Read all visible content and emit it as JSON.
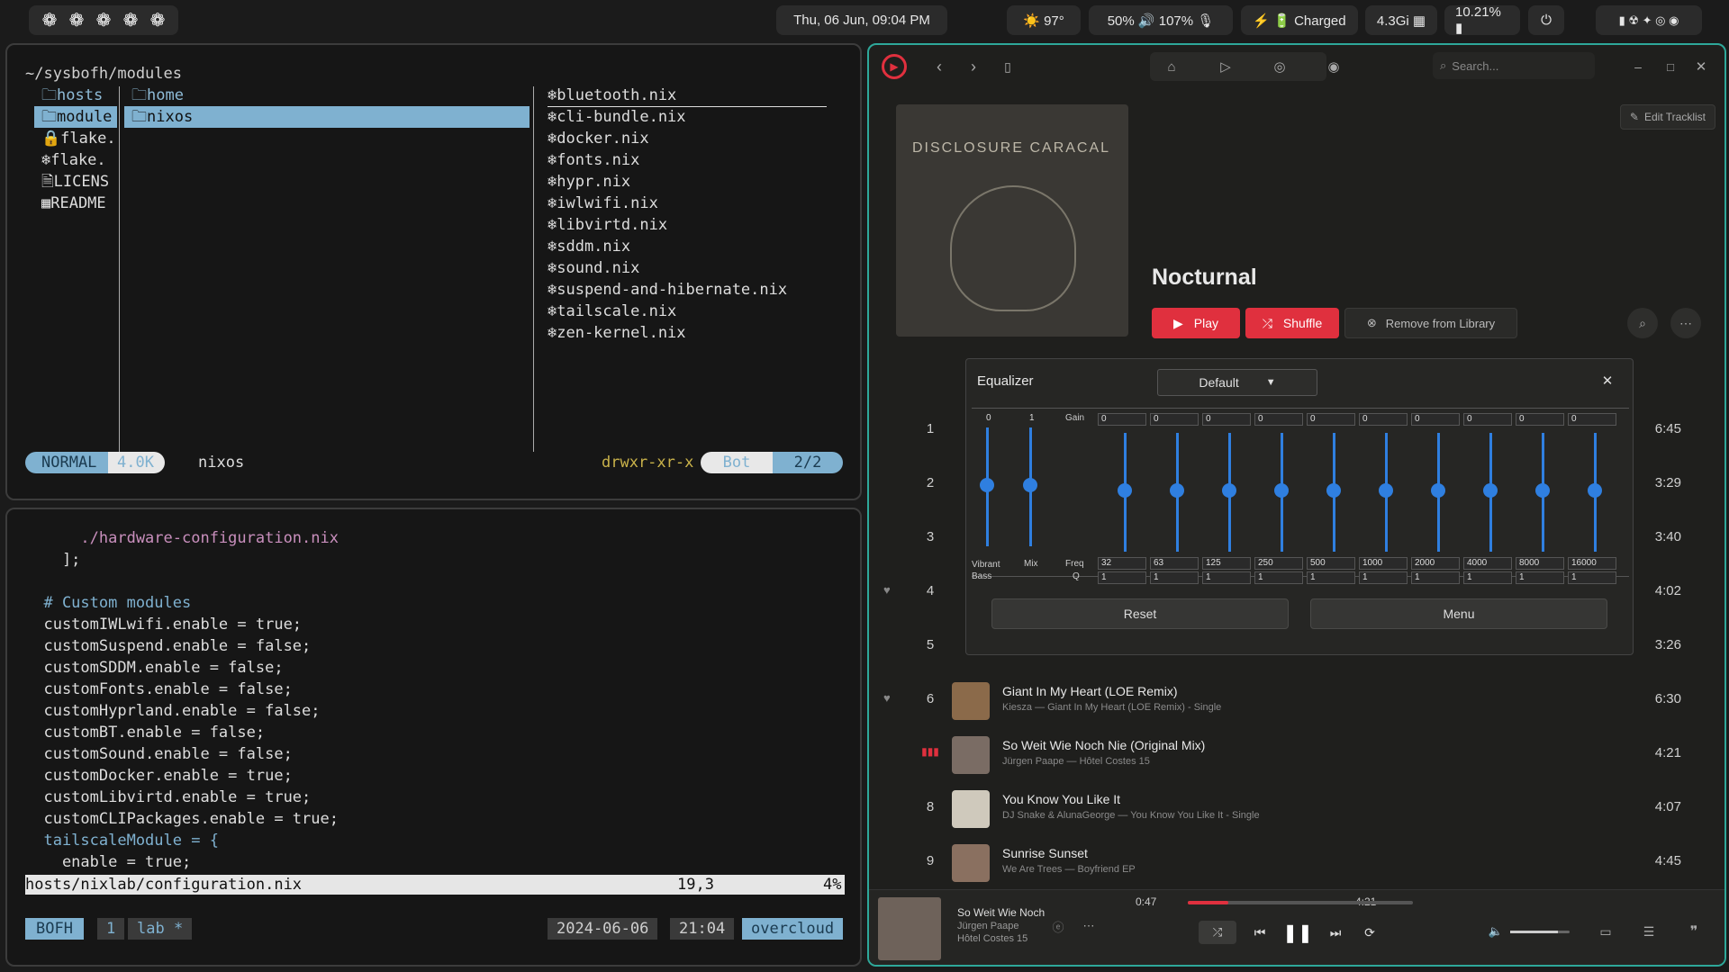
{
  "topbar": {
    "workspaces": [
      "❁",
      "❁",
      "❁",
      "❁",
      "❁"
    ],
    "clock": "Thu, 06 Jun, 09:04 PM",
    "weather": "☀️ 97°",
    "audio": "50% 🔊 107% 🎙",
    "battery": "⚡ 🔋 Charged",
    "memory": "4.3Gi ▦",
    "cpu": "10.21% ▮",
    "power_icon": "⏻",
    "tray_icons": "▮ ☢ ✦ ◎ ◉"
  },
  "files": {
    "path": "~/sysbofh/modules",
    "col1": [
      "🗀hosts",
      "🗀module",
      "🔒flake.",
      "❄flake.",
      "🗎LICENS",
      "▦README"
    ],
    "col2": [
      "🗀home",
      "🗀nixos"
    ],
    "col3": [
      "❄bluetooth.nix",
      "❄cli-bundle.nix",
      "❄docker.nix",
      "❄fonts.nix",
      "❄hypr.nix",
      "❄iwlwifi.nix",
      "❄libvirtd.nix",
      "❄sddm.nix",
      "❄sound.nix",
      "❄suspend-and-hibernate.nix",
      "❄tailscale.nix",
      "❄zen-kernel.nix"
    ],
    "mode": "NORMAL",
    "size": "4.0K",
    "current": "nixos",
    "perms": "drwxr-xr-x",
    "pos_label": "Bot",
    "pos": "2/2"
  },
  "editor": {
    "lines": [
      "      ./hardware-configuration.nix",
      "    ];",
      "",
      "  # Custom modules",
      "  customIWLwifi.enable = true;",
      "  customSuspend.enable = false;",
      "  customSDDM.enable = false;",
      "  customFonts.enable = false;",
      "  customHyprland.enable = false;",
      "  customBT.enable = false;",
      "  customSound.enable = false;",
      "  customDocker.enable = true;",
      "  customLibvirtd.enable = true;",
      "  customCLIPackages.enable = true;",
      "  tailscaleModule = {",
      "    enable = true;"
    ],
    "status_file": "hosts/nixlab/configuration.nix",
    "status_pos": "19,3",
    "status_pct": "4%",
    "tmux_session": "BOFH",
    "tmux_win": "1",
    "tmux_name": "lab *",
    "date": "2024-06-06",
    "time": "21:04",
    "host": "overcloud"
  },
  "music": {
    "search_placeholder": "Search...",
    "edit_tracklist": "Edit Tracklist",
    "album_art_text": "DISCLOSURE CARACAL",
    "album_title": "Nocturnal",
    "play": "Play",
    "shuffle": "Shuffle",
    "remove": "Remove from Library",
    "tracks": [
      {
        "n": "1",
        "title": "",
        "sub": "",
        "dur": "6:45"
      },
      {
        "n": "2",
        "title": "",
        "sub": "",
        "dur": "3:29"
      },
      {
        "n": "3",
        "title": "",
        "sub": "",
        "dur": "3:40"
      },
      {
        "n": "4",
        "title": "",
        "sub": "",
        "dur": "4:02"
      },
      {
        "n": "5",
        "title": "",
        "sub": "",
        "dur": "3:26"
      },
      {
        "n": "6",
        "title": "Giant In My Heart (LOE Remix)",
        "sub": "Kiesza — Giant In My Heart (LOE Remix) - Single",
        "dur": "6:30"
      },
      {
        "n": "",
        "title": "So Weit Wie Noch Nie (Original Mix)",
        "sub": "Jürgen Paape — Hôtel Costes 15",
        "dur": "4:21"
      },
      {
        "n": "8",
        "title": "You Know You Like It",
        "sub": "DJ Snake & AlunaGeorge — You Know You Like It - Single",
        "dur": "4:07"
      },
      {
        "n": "9",
        "title": "Sunrise Sunset",
        "sub": "We Are Trees — Boyfriend EP",
        "dur": "4:45"
      }
    ],
    "now_playing": {
      "title": "So Weit Wie Noch",
      "artist": "Jürgen Paape",
      "album": "Hôtel Costes 15",
      "elapsed": "0:47",
      "total": "4:21",
      "progress": 0.18,
      "volume": 0.8
    }
  },
  "equalizer": {
    "title": "Equalizer",
    "preset": "Default",
    "gain_label": "Gain",
    "freq_label": "Freq",
    "q_label": "Q",
    "vibrant_value": "0",
    "mix_value": "1",
    "vibrant_label": "Vibrant Bass",
    "mix_label": "Mix",
    "bands": [
      {
        "gain": "0",
        "freq": "32",
        "q": "1"
      },
      {
        "gain": "0",
        "freq": "63",
        "q": "1"
      },
      {
        "gain": "0",
        "freq": "125",
        "q": "1"
      },
      {
        "gain": "0",
        "freq": "250",
        "q": "1"
      },
      {
        "gain": "0",
        "freq": "500",
        "q": "1"
      },
      {
        "gain": "0",
        "freq": "1000",
        "q": "1"
      },
      {
        "gain": "0",
        "freq": "2000",
        "q": "1"
      },
      {
        "gain": "0",
        "freq": "4000",
        "q": "1"
      },
      {
        "gain": "0",
        "freq": "8000",
        "q": "1"
      },
      {
        "gain": "0",
        "freq": "16000",
        "q": "1"
      }
    ],
    "reset": "Reset",
    "menu": "Menu"
  }
}
